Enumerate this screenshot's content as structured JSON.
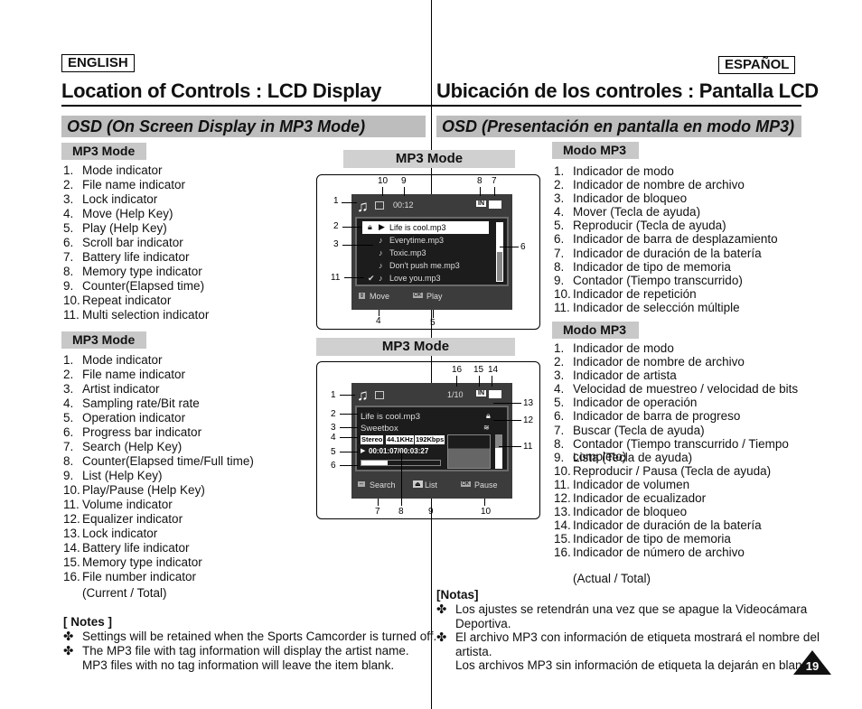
{
  "header": {
    "left_lang": "ENGLISH",
    "right_lang": "ESPAÑOL",
    "left_title": "Location of Controls : LCD Display",
    "right_title": "Ubicación de los controles : Pantalla LCD",
    "left_section": "OSD (On Screen Display in MP3 Mode)",
    "right_section": "OSD (Presentación en pantalla en modo MP3)"
  },
  "english": {
    "list1_title": "MP3 Mode",
    "list1": [
      "Mode indicator",
      "File name indicator",
      "Lock indicator",
      "Move (Help Key)",
      "Play (Help Key)",
      "Scroll bar indicator",
      "Battery life indicator",
      "Memory type indicator",
      "Counter(Elapsed time)",
      "Repeat indicator",
      "Multi selection indicator"
    ],
    "list2_title": "MP3 Mode",
    "list2": [
      "Mode indicator",
      "File name indicator",
      "Artist indicator",
      "Sampling rate/Bit rate",
      "Operation indicator",
      "Progress bar indicator",
      "Search (Help Key)",
      "Counter(Elapsed time/Full time)",
      "List (Help Key)",
      "Play/Pause (Help Key)",
      "Volume indicator",
      "Equalizer indicator",
      "Lock indicator",
      "Battery life indicator",
      "Memory type indicator",
      "File number indicator"
    ],
    "list2_cont": "(Current / Total)",
    "notes_title": "[ Notes ]",
    "notes": [
      "Settings will be retained when the Sports Camcorder is turned off.",
      "The MP3 file with tag information will display the artist name.",
      "MP3 files with no tag information will leave the item blank."
    ]
  },
  "spanish": {
    "list1_title": "Modo MP3",
    "list1": [
      "Indicador de modo",
      "Indicador de nombre de archivo",
      "Indicador de bloqueo",
      "Mover (Tecla de ayuda)",
      "Reproducir (Tecla de ayuda)",
      "Indicador de barra de desplazamiento",
      "Indicador de duración de la batería",
      "Indicador de tipo de memoria",
      "Contador (Tiempo transcurrido)",
      "Indicador de repetición",
      "Indicador de selección múltiple"
    ],
    "list2_title": "Modo MP3",
    "list2": [
      "Indicador de modo",
      "Indicador de nombre de archivo",
      "Indicador de artista",
      "Velocidad de muestreo / velocidad de bits",
      "Indicador de operación",
      "Indicador de barra de progreso",
      "Buscar (Tecla de ayuda)",
      "Contador (Tiempo transcurrido / Tiempo",
      "Lista (Tecla de ayuda)",
      "Reproducir / Pausa (Tecla de ayuda)",
      "Indicador de volumen",
      "Indicador de ecualizador",
      "Indicador de bloqueo",
      "Indicador de duración de la batería",
      "Indicador de tipo de memoria",
      "Indicador de número de archivo"
    ],
    "list2_cont8": "completo)",
    "list2_cont16": "(Actual / Total)",
    "notes_title": "[Notas]",
    "notes": [
      "Los ajustes se retendrán una vez que se apague la Videocámara",
      "Deportiva.",
      "El archivo MP3 con información de etiqueta mostrará el nombre del",
      "artista.",
      "Los archivos MP3 sin información de etiqueta la dejarán en blanco."
    ]
  },
  "screen1": {
    "title": "MP3 Mode",
    "time": "00:12",
    "memory": "IN",
    "files": [
      "Life is cool.mp3",
      "Everytime.mp3",
      "Toxic.mp3",
      "Don't push me.mp3",
      "Love you.mp3"
    ],
    "help_move": "Move",
    "help_play": "Play",
    "ok": "OK",
    "scroll_fraction": 0.5,
    "callouts": [
      "1",
      "2",
      "3",
      "4",
      "5",
      "6",
      "7",
      "8",
      "9",
      "10",
      "11"
    ]
  },
  "screen2": {
    "title": "MP3 Mode",
    "file_number": "1/10",
    "memory": "IN",
    "file": "Life is cool.mp3",
    "artist": "Sweetbox",
    "stereo": "Stereo",
    "sampling": "44.1KHz",
    "bitrate": "192Kbps",
    "counter": "00:01:07/00:03:27",
    "progress": 0.33,
    "help_search": "Search",
    "help_list": "List",
    "help_pause": "Pause",
    "ok": "OK",
    "callouts": [
      "1",
      "2",
      "3",
      "4",
      "5",
      "6",
      "7",
      "8",
      "9",
      "10",
      "11",
      "12",
      "13",
      "14",
      "15",
      "16"
    ]
  },
  "page_number": "19"
}
